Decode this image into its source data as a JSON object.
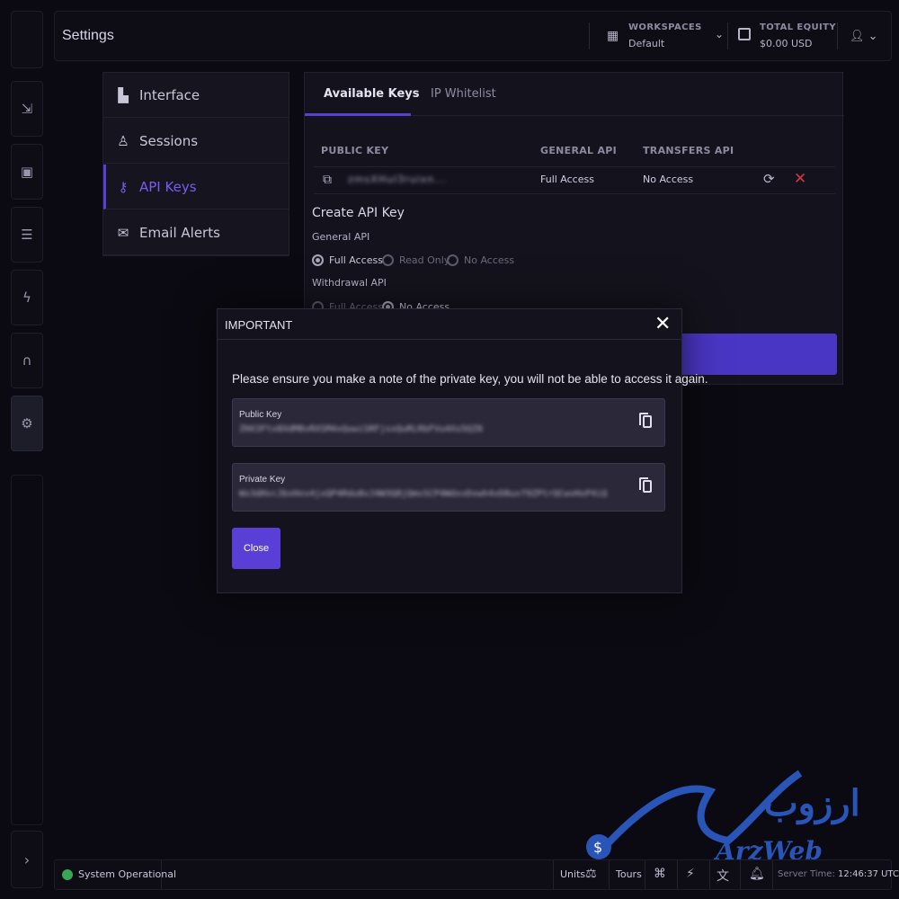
{
  "header": {
    "title": "Settings",
    "workspaces": {
      "label": "WORKSPACES",
      "value": "Default"
    },
    "equity": {
      "label": "TOTAL EQUITY",
      "value": "$0.00 USD"
    }
  },
  "settings_menu": [
    {
      "label": "Interface",
      "icon": "layout-icon"
    },
    {
      "label": "Sessions",
      "icon": "user-sessions-icon"
    },
    {
      "label": "API Keys",
      "icon": "key-icon",
      "active": true
    },
    {
      "label": "Email Alerts",
      "icon": "mail-icon"
    }
  ],
  "tabs": [
    "Available Keys",
    "IP Whitelist"
  ],
  "table": {
    "headers": [
      "PUBLIC KEY",
      "GENERAL API",
      "TRANSFERS API"
    ],
    "rows": [
      {
        "public_key": "zmsXHuI3ruixn...",
        "general_api": "Full Access",
        "transfers_api": "No Access"
      }
    ]
  },
  "create": {
    "title": "Create API Key",
    "general_label": "General API",
    "general_options": [
      "Full Access",
      "Read Only",
      "No Access"
    ],
    "withdrawal_label": "Withdrawal API",
    "withdrawal_options": [
      "Full Access",
      "No Access"
    ]
  },
  "modal": {
    "title": "IMPORTANT",
    "message": "Please ensure you make a note of the private key, you will not be able to access it again.",
    "public_key_label": "Public Key",
    "public_key_value": "ZHX3Ftx8XdM8vRXSM4xQuwiSRFjsxQuRLRbFVu4Xs5QZ8",
    "private_key_label": "Private Key",
    "private_key_value": "Wx3dHvcJbxHxv4jxQP4Rdu8vJ4W3Q8jQmvSCP4WdxvDvwh4vD8uxf9ZPtrQCwvHxP4iQ",
    "close_label": "Close"
  },
  "footer": {
    "status": "System Operational",
    "units": "Units",
    "tours": "Tours",
    "server_time_label": "Server Time:",
    "server_time": "12:46:37 UTC"
  },
  "watermark": {
    "fa": "ارزوب",
    "en": "ArzWeb"
  },
  "colors": {
    "accent": "#5a3fd6",
    "danger": "#d23b3b",
    "success": "#3aa655"
  }
}
